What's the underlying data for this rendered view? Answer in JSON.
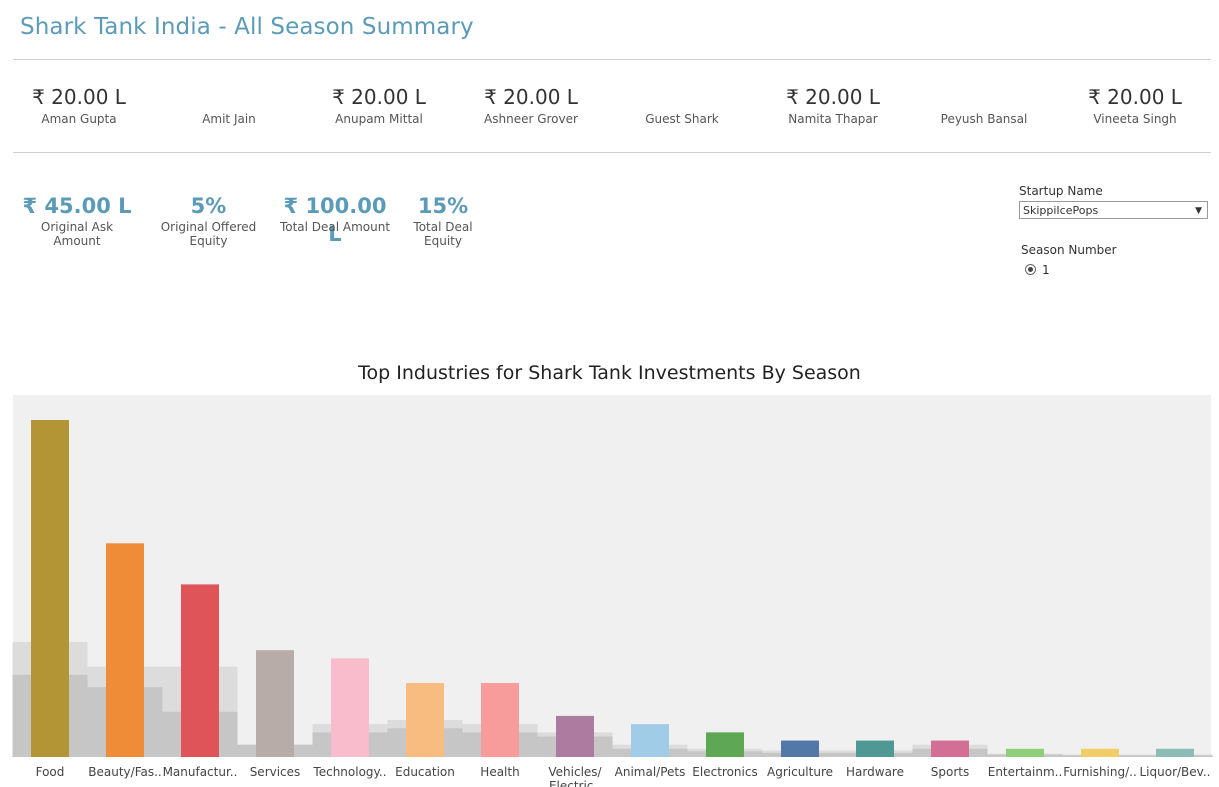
{
  "header": {
    "title": "Shark Tank India - All Season Summary"
  },
  "sharks": [
    {
      "name": "Aman Gupta",
      "amount": "₹ 20.00 L"
    },
    {
      "name": "Amit Jain",
      "amount": ""
    },
    {
      "name": "Anupam Mittal",
      "amount": "₹ 20.00 L"
    },
    {
      "name": "Ashneer Grover",
      "amount": "₹ 20.00 L"
    },
    {
      "name": "Guest Shark",
      "amount": ""
    },
    {
      "name": "Namita Thapar",
      "amount": "₹ 20.00 L"
    },
    {
      "name": "Peyush Bansal",
      "amount": ""
    },
    {
      "name": "Vineeta Singh",
      "amount": "₹ 20.00 L"
    }
  ],
  "kpis": [
    {
      "value": "₹ 45.00 L",
      "label": "Original Ask Amount"
    },
    {
      "value": "5%",
      "label": "Original Offered Equity"
    },
    {
      "value": "₹ 100.00 L",
      "label": "Total Deal Amount"
    },
    {
      "value": "15%",
      "label": "Total Deal Equity"
    }
  ],
  "filters": {
    "startup_label": "Startup Name",
    "startup_value": "SkippiIcePops",
    "season_label": "Season Number",
    "season_value": "1"
  },
  "colors": {
    "accent": "#5b9bb8",
    "plot_bg": "#f0f0f0"
  },
  "chart_data": {
    "type": "bar",
    "title": "Top Industries for Shark Tank Investments By Season",
    "xlabel": "",
    "ylabel": "",
    "ylim": [
      0,
      41
    ],
    "grid": false,
    "categories": [
      "Food",
      "Beauty/Fas..",
      "Manufactur..",
      "Services",
      "Technology..",
      "Education",
      "Health",
      "Vehicles/ Electric..",
      "Animal/Pets",
      "Electronics",
      "Agriculture",
      "Hardware",
      "Sports",
      "Entertainm..",
      "Furnishing/..",
      "Liquor/Bev.."
    ],
    "values": [
      41,
      26,
      21,
      13,
      12,
      9,
      9,
      5,
      4,
      3,
      2,
      2,
      2,
      1,
      1,
      1
    ],
    "colors": [
      "#b39535",
      "#ee8c37",
      "#de5459",
      "#b7aca7",
      "#f8bccc",
      "#f9bc80",
      "#f79c9b",
      "#ad7aa0",
      "#a1cce8",
      "#5ea755",
      "#5178a6",
      "#4f9893",
      "#d36e94",
      "#8fcf7a",
      "#f0cd65",
      "#8bbdb4"
    ],
    "background_series": [
      {
        "values": [
          14,
          11,
          11,
          1.5,
          4,
          4.5,
          4,
          3,
          1.5,
          1,
          0.8,
          0.8,
          1.5,
          0.4,
          0.3,
          0.3
        ]
      },
      {
        "values": [
          10,
          8.5,
          5.5,
          1.5,
          3,
          3.5,
          3,
          2.5,
          1,
          0.7,
          0.5,
          0.5,
          1,
          0.3,
          0.2,
          0.2
        ]
      }
    ]
  }
}
